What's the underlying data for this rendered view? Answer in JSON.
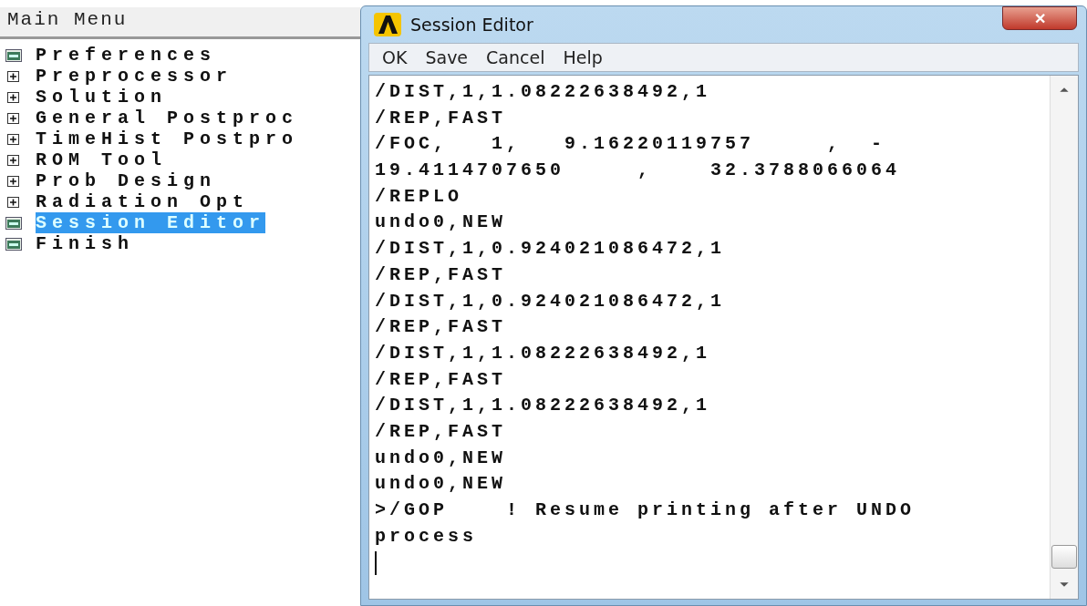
{
  "main_menu": {
    "title": "Main Menu",
    "items": [
      {
        "label": "Preferences",
        "kind": "page",
        "selected": false
      },
      {
        "label": "Preprocessor",
        "kind": "folder",
        "selected": false
      },
      {
        "label": "Solution",
        "kind": "folder",
        "selected": false
      },
      {
        "label": "General Postproc",
        "kind": "folder",
        "selected": false
      },
      {
        "label": "TimeHist Postpro",
        "kind": "folder",
        "selected": false
      },
      {
        "label": "ROM Tool",
        "kind": "folder",
        "selected": false
      },
      {
        "label": "Prob Design",
        "kind": "folder",
        "selected": false
      },
      {
        "label": "Radiation Opt",
        "kind": "folder",
        "selected": false
      },
      {
        "label": "Session Editor",
        "kind": "page",
        "selected": true
      },
      {
        "label": "Finish",
        "kind": "page",
        "selected": false
      }
    ]
  },
  "window": {
    "title": "Session Editor",
    "close": "✕"
  },
  "menu": [
    "OK",
    "Save",
    "Cancel",
    "Help"
  ],
  "editor": {
    "lines": [
      "/DIST,1,1.08222638492,1",
      "/REP,FAST",
      "/FOC,   1,   9.16220119757     ,  -",
      "19.4114707650     ,    32.3788066064",
      "/REPLO",
      "undo0,NEW",
      "/DIST,1,0.924021086472,1",
      "/REP,FAST",
      "/DIST,1,0.924021086472,1",
      "/REP,FAST",
      "/DIST,1,1.08222638492,1",
      "/REP,FAST",
      "/DIST,1,1.08222638492,1",
      "/REP,FAST",
      "undo0,NEW",
      "undo0,NEW",
      ">/GOP    ! Resume printing after UNDO",
      "process"
    ]
  }
}
